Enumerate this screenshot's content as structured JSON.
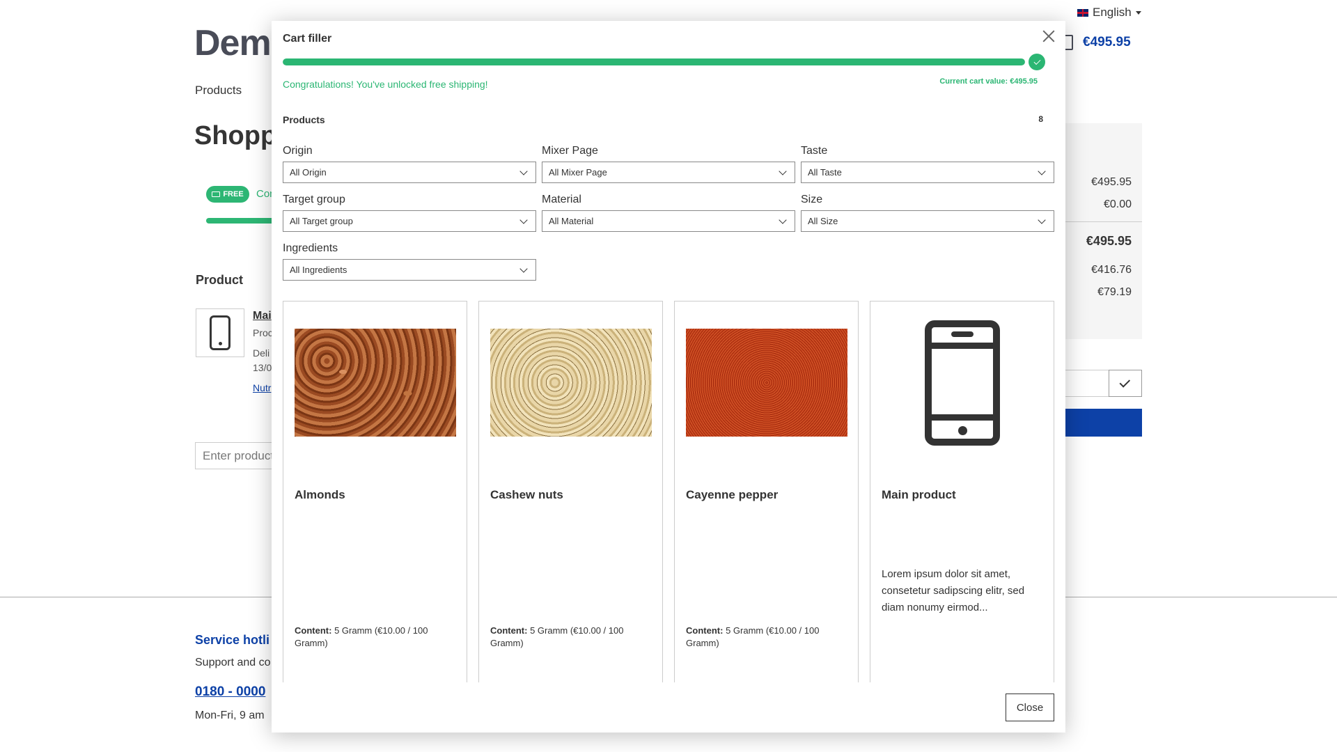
{
  "background": {
    "language": "English",
    "logo_text": "Dem",
    "cart_total": "€495.95",
    "nav_products": "Products",
    "page_heading": "Shopp",
    "free_badge": "FREE",
    "free_text": "Con",
    "product_column_header": "Product",
    "line_item": {
      "name": "Mai",
      "product_number": "Proc",
      "delivery": "Deli",
      "delivery_date": "13/0",
      "link": "Nutr"
    },
    "product_input_placeholder": "Enter product",
    "summary_values": [
      "€495.95",
      "€0.00",
      "€495.95",
      "€416.76",
      "€79.19"
    ],
    "footer": {
      "hotline": "Service hotli",
      "support": "Support and co",
      "phone": "0180 - 0000",
      "hours": "Mon-Fri, 9 am"
    }
  },
  "modal": {
    "title": "Cart filler",
    "progress_fraction": 1.0,
    "congrats": "Congratulations! You've unlocked free shipping!",
    "cart_value": "Current cart value: €495.95",
    "products_heading": "Products",
    "products_count": "8",
    "filters": [
      {
        "label": "Origin",
        "value": "All Origin"
      },
      {
        "label": "Mixer Page",
        "value": "All Mixer Page"
      },
      {
        "label": "Taste",
        "value": "All Taste"
      },
      {
        "label": "Target group",
        "value": "All Target group"
      },
      {
        "label": "Material",
        "value": "All Material"
      },
      {
        "label": "Size",
        "value": "All Size"
      },
      {
        "label": "Ingredients",
        "value": "All Ingredients"
      }
    ],
    "products": [
      {
        "name": "Almonds",
        "content_label": "Content:",
        "content_value": "5 Gramm (€10.00 / 100 Gramm)",
        "description": ""
      },
      {
        "name": "Cashew nuts",
        "content_label": "Content:",
        "content_value": "5 Gramm (€10.00 / 100 Gramm)",
        "description": ""
      },
      {
        "name": "Cayenne pepper",
        "content_label": "Content:",
        "content_value": "5 Gramm (€10.00 / 100 Gramm)",
        "description": ""
      },
      {
        "name": "Main product",
        "content_label": "",
        "content_value": "",
        "description": "Lorem ipsum dolor sit amet, consetetur sadipscing elitr, sed diam nonumy eirmod..."
      }
    ],
    "close_label": "Close"
  },
  "colors": {
    "accent_green": "#2bb673",
    "brand_blue": "#0b3fa6"
  }
}
